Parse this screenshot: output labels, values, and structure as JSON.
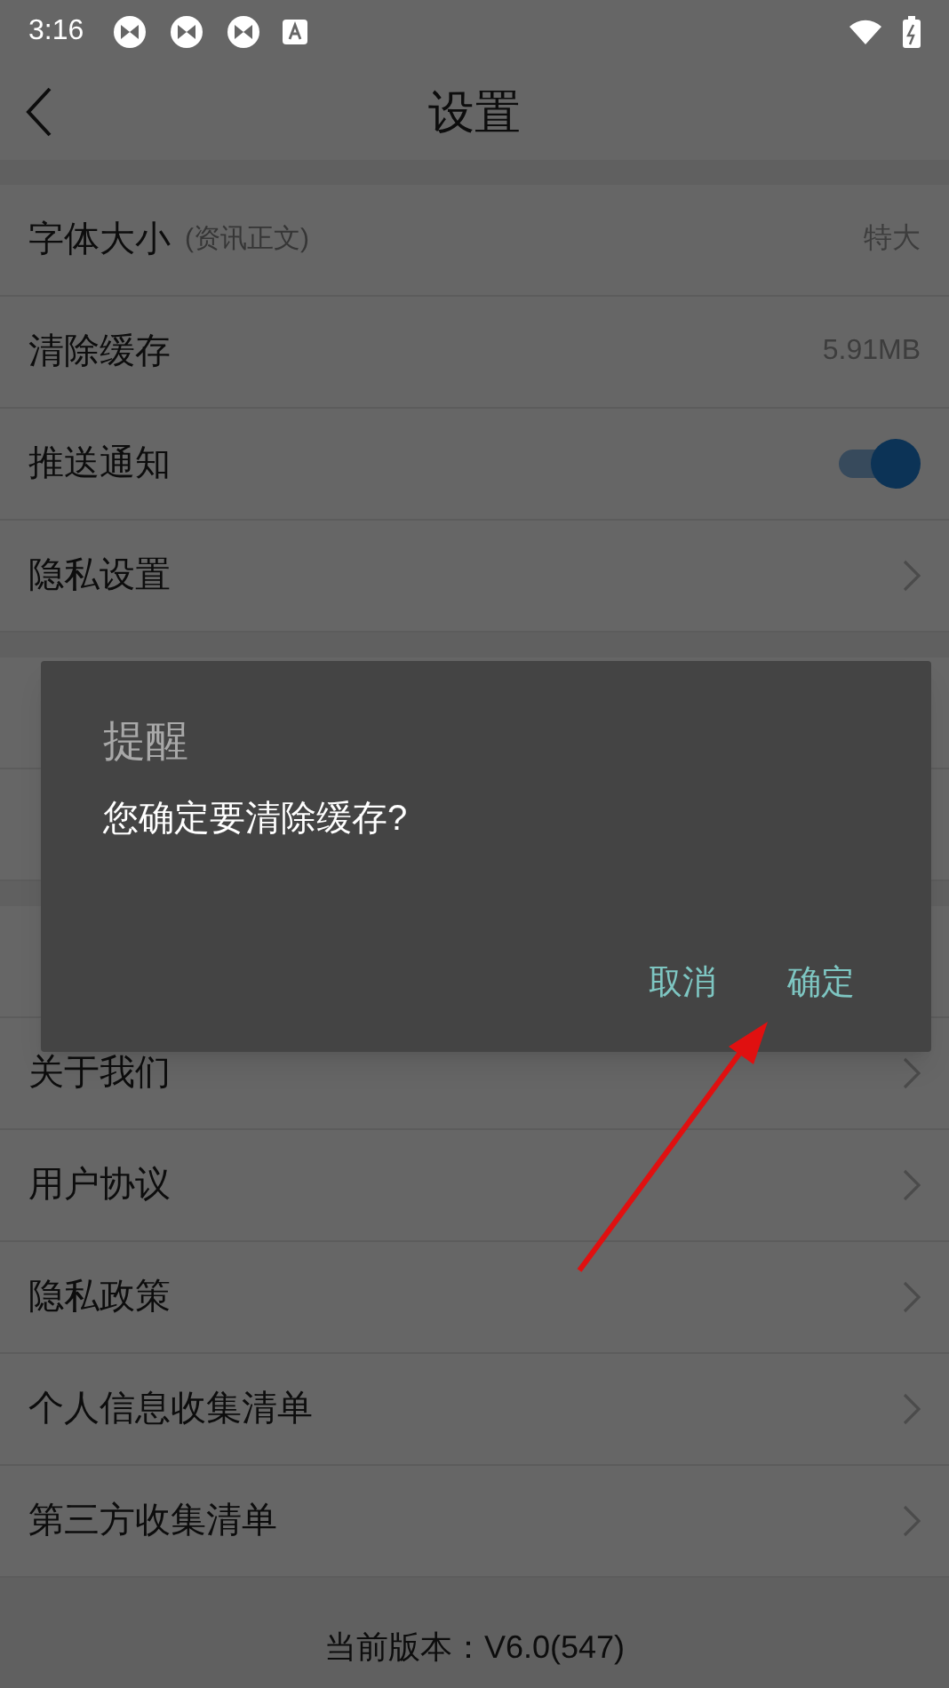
{
  "status_bar": {
    "time": "3:16"
  },
  "header": {
    "title": "设置"
  },
  "sections": [
    {
      "items": [
        {
          "kind": "value",
          "label": "字体大小",
          "note": "(资讯正文)",
          "value": "特大"
        },
        {
          "kind": "value",
          "label": "清除缓存",
          "value": "5.91MB"
        },
        {
          "kind": "toggle",
          "label": "推送通知",
          "on": true
        },
        {
          "kind": "link",
          "label": "隐私设置"
        }
      ]
    },
    {
      "items": [
        {
          "kind": "covered"
        },
        {
          "kind": "covered"
        }
      ]
    },
    {
      "items": [
        {
          "kind": "covered"
        },
        {
          "kind": "link",
          "label": "关于我们"
        },
        {
          "kind": "link",
          "label": "用户协议"
        },
        {
          "kind": "link",
          "label": "隐私政策"
        },
        {
          "kind": "link",
          "label": "个人信息收集清单"
        },
        {
          "kind": "link",
          "label": "第三方收集清单"
        }
      ]
    }
  ],
  "footer": {
    "version": "当前版本：V6.0(547)"
  },
  "dialog": {
    "title": "提醒",
    "message": "您确定要清除缓存?",
    "buttons": [
      "取消",
      "确定"
    ]
  }
}
